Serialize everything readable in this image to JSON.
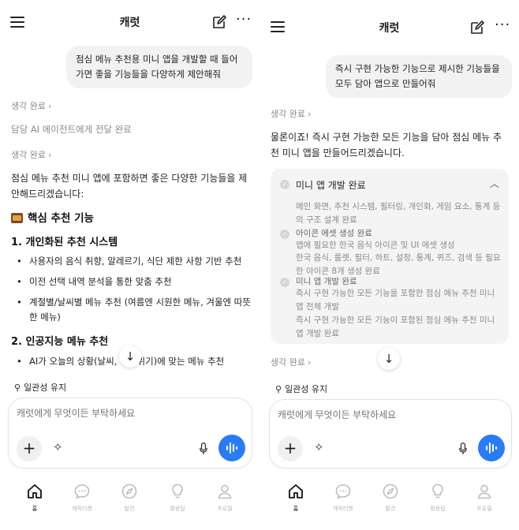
{
  "left": {
    "header": {
      "title": "캐럿"
    },
    "user_message": "점심 메뉴 추천용 미니 앱을 개발할 때 들어가면 좋을 기능들을 다양하게 제안해줘",
    "thinking_1": "생각 완료",
    "handoff": "담당 AI 에이전트에게 전달 완료",
    "thinking_2": "생각 완료",
    "intro": "점심 메뉴 추천 미니 앱에 포함하면 좋은 다양한 기능들을 제안해드리겠습니다:",
    "section_title": "핵심 추천 기능",
    "sub1_title": "1. 개인화된 추천 시스템",
    "sub1_items": [
      "사용자의 음식 취향, 알레르기, 식단 제한 사항 기반 추천",
      "이전 선택 내역 분석을 통한 맞춤 추천",
      "계절별/날씨별 메뉴 추천 (여름엔 시원한 메뉴, 겨울엔 따뜻한 메뉴)"
    ],
    "sub2_title": "2. 인공지능 메뉴 추천",
    "sub2_items": [
      "AI가 오늘의 상황(날씨, ·, 분위기)에 맞는 메뉴 추천"
    ],
    "pin_label": "일관성 유지",
    "composer_placeholder": "캐럿에게 무엇이든 부탁하세요"
  },
  "right": {
    "header": {
      "title": "캐럿"
    },
    "user_message": "즉시 구현 가능한 기능으로 제시한 기능들을 모두 담아 앱으로 만들어줘",
    "thinking_1": "생각 완료",
    "reply": "물론이죠! 즉시 구현 가능한 모든 기능을 담아 점심 메뉴 추천 미니 앱을 만들어드리겠습니다.",
    "card": {
      "title": "미니 앱 개발 완료",
      "detail_1": "메인 화면, 추천 시스템, 필터링, 개인화, 게임 요소, 통계 등의 구조 설계 완료",
      "step_2_title": "아이콘 에셋 생성 완료",
      "detail_2a": "앱에 필요한 한국 음식 아이콘 및 UI 에셋 생성",
      "detail_2b": "한국 음식, 룰렛, 필터, 하트, 설정, 통계, 퀴즈, 검색 등 필요한 아이콘 8개 생성 완료",
      "step_3_title": "미니 앱 개발 완료",
      "detail_3a": "즉시 구현 가능한 모든 기능을 포함한 점심 메뉴 추천 미니 앱 전체 개발",
      "detail_3b": "즉시 구현 가능한 모든 기능이 포함된 점심 메뉴 추천 미니 앱 개발 완료"
    },
    "thinking_2": "생각 완료",
    "pin_label": "일관성 유지",
    "composer_placeholder": "캐럿에게 무엇이든 부탁하세요"
  },
  "tabs": [
    {
      "label": "홈",
      "icon": "home-icon"
    },
    {
      "label": "캐릭터챗",
      "icon": "chat-icon"
    },
    {
      "label": "발견",
      "icon": "compass-icon"
    },
    {
      "label": "활용팁",
      "icon": "lightbulb-icon"
    },
    {
      "label": "프로필",
      "icon": "profile-icon"
    }
  ],
  "colors": {
    "accent": "#2a7cf6",
    "bubble": "#f2f2f2",
    "card": "#f4f4f4"
  }
}
